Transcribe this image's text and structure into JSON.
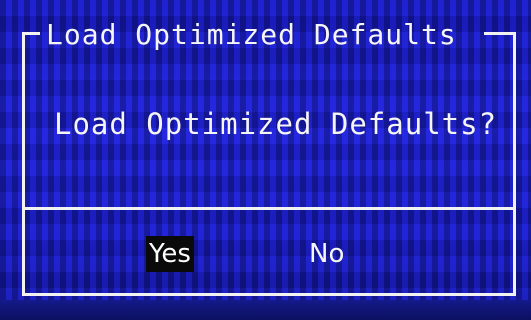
{
  "dialog": {
    "title": "Load Optimized Defaults",
    "message": "Load Optimized Defaults?",
    "options": [
      {
        "label": "Yes",
        "selected": true
      },
      {
        "label": "No",
        "selected": false
      }
    ]
  },
  "colors": {
    "background": "#2226d6",
    "border": "#f2f2f2",
    "text": "#f5f5f5",
    "selection_background": "#0a0a0a"
  }
}
